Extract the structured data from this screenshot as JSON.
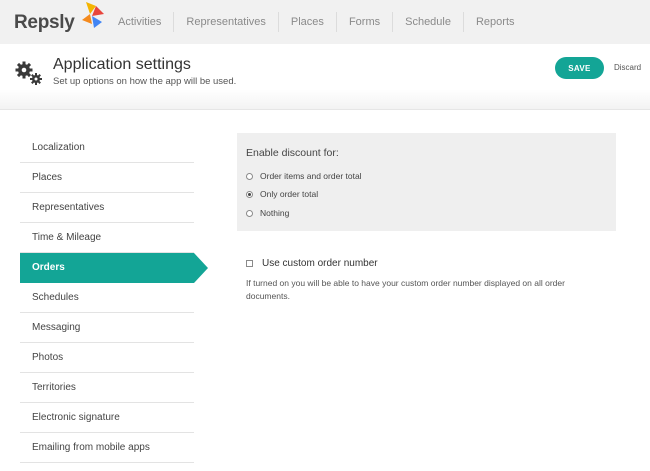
{
  "app": {
    "logo_text": "Repsly",
    "brand_color": "#13a596"
  },
  "nav": {
    "items": [
      "Activities",
      "Representatives",
      "Places",
      "Forms",
      "Schedule",
      "Reports"
    ]
  },
  "header": {
    "icon": "gears-icon",
    "title": "Application settings",
    "subtitle": "Set up options on how the app will be used.",
    "save_label": "SAVE",
    "discard_label": "Discard"
  },
  "sidebar": {
    "items": [
      {
        "label": "Localization",
        "active": false
      },
      {
        "label": "Places",
        "active": false
      },
      {
        "label": "Representatives",
        "active": false
      },
      {
        "label": "Time & Mileage",
        "active": false
      },
      {
        "label": "Orders",
        "active": true
      },
      {
        "label": "Schedules",
        "active": false
      },
      {
        "label": "Messaging",
        "active": false
      },
      {
        "label": "Photos",
        "active": false
      },
      {
        "label": "Territories",
        "active": false
      },
      {
        "label": "Electronic signature",
        "active": false
      },
      {
        "label": "Emailing from mobile apps",
        "active": false
      }
    ]
  },
  "discount": {
    "title": "Enable discount for:",
    "options": [
      {
        "label": "Order items and order total",
        "selected": false
      },
      {
        "label": "Only order total",
        "selected": true
      },
      {
        "label": "Nothing",
        "selected": false
      }
    ]
  },
  "custom_order": {
    "label": "Use custom order number",
    "checked": false,
    "description": "If turned on you will be able to have your custom order number displayed  on all order documents."
  }
}
